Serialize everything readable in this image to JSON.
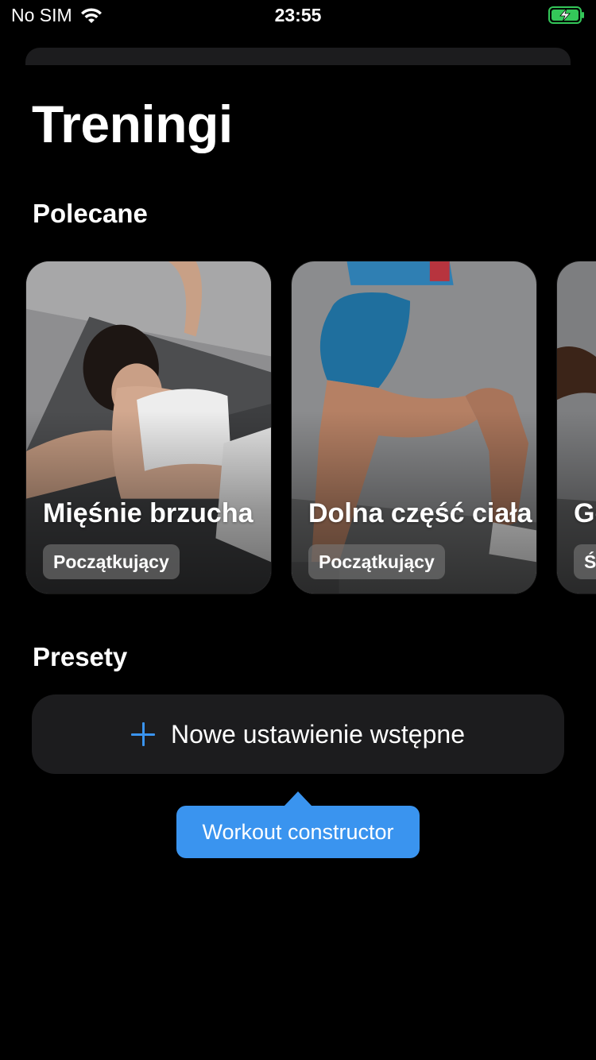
{
  "status_bar": {
    "carrier": "No SIM",
    "time": "23:55",
    "wifi_icon": "wifi-icon",
    "battery_icon": "battery-charging-icon",
    "battery_color": "#34c759"
  },
  "page": {
    "title": "Treningi"
  },
  "recommended": {
    "title": "Polecane",
    "cards": [
      {
        "title": "Mięśnie brzucha",
        "level": "Początkujący"
      },
      {
        "title": "Dolna część ciała",
        "level": "Początkujący"
      },
      {
        "title": "Gó",
        "level": "Ś"
      }
    ]
  },
  "presets": {
    "title": "Presety",
    "new_preset_label": "Nowe ustawienie wstępne",
    "plus_icon": "plus-icon",
    "accent_color": "#3a94ef"
  },
  "tooltip": {
    "text": "Workout constructor",
    "color": "#3a94ef"
  }
}
